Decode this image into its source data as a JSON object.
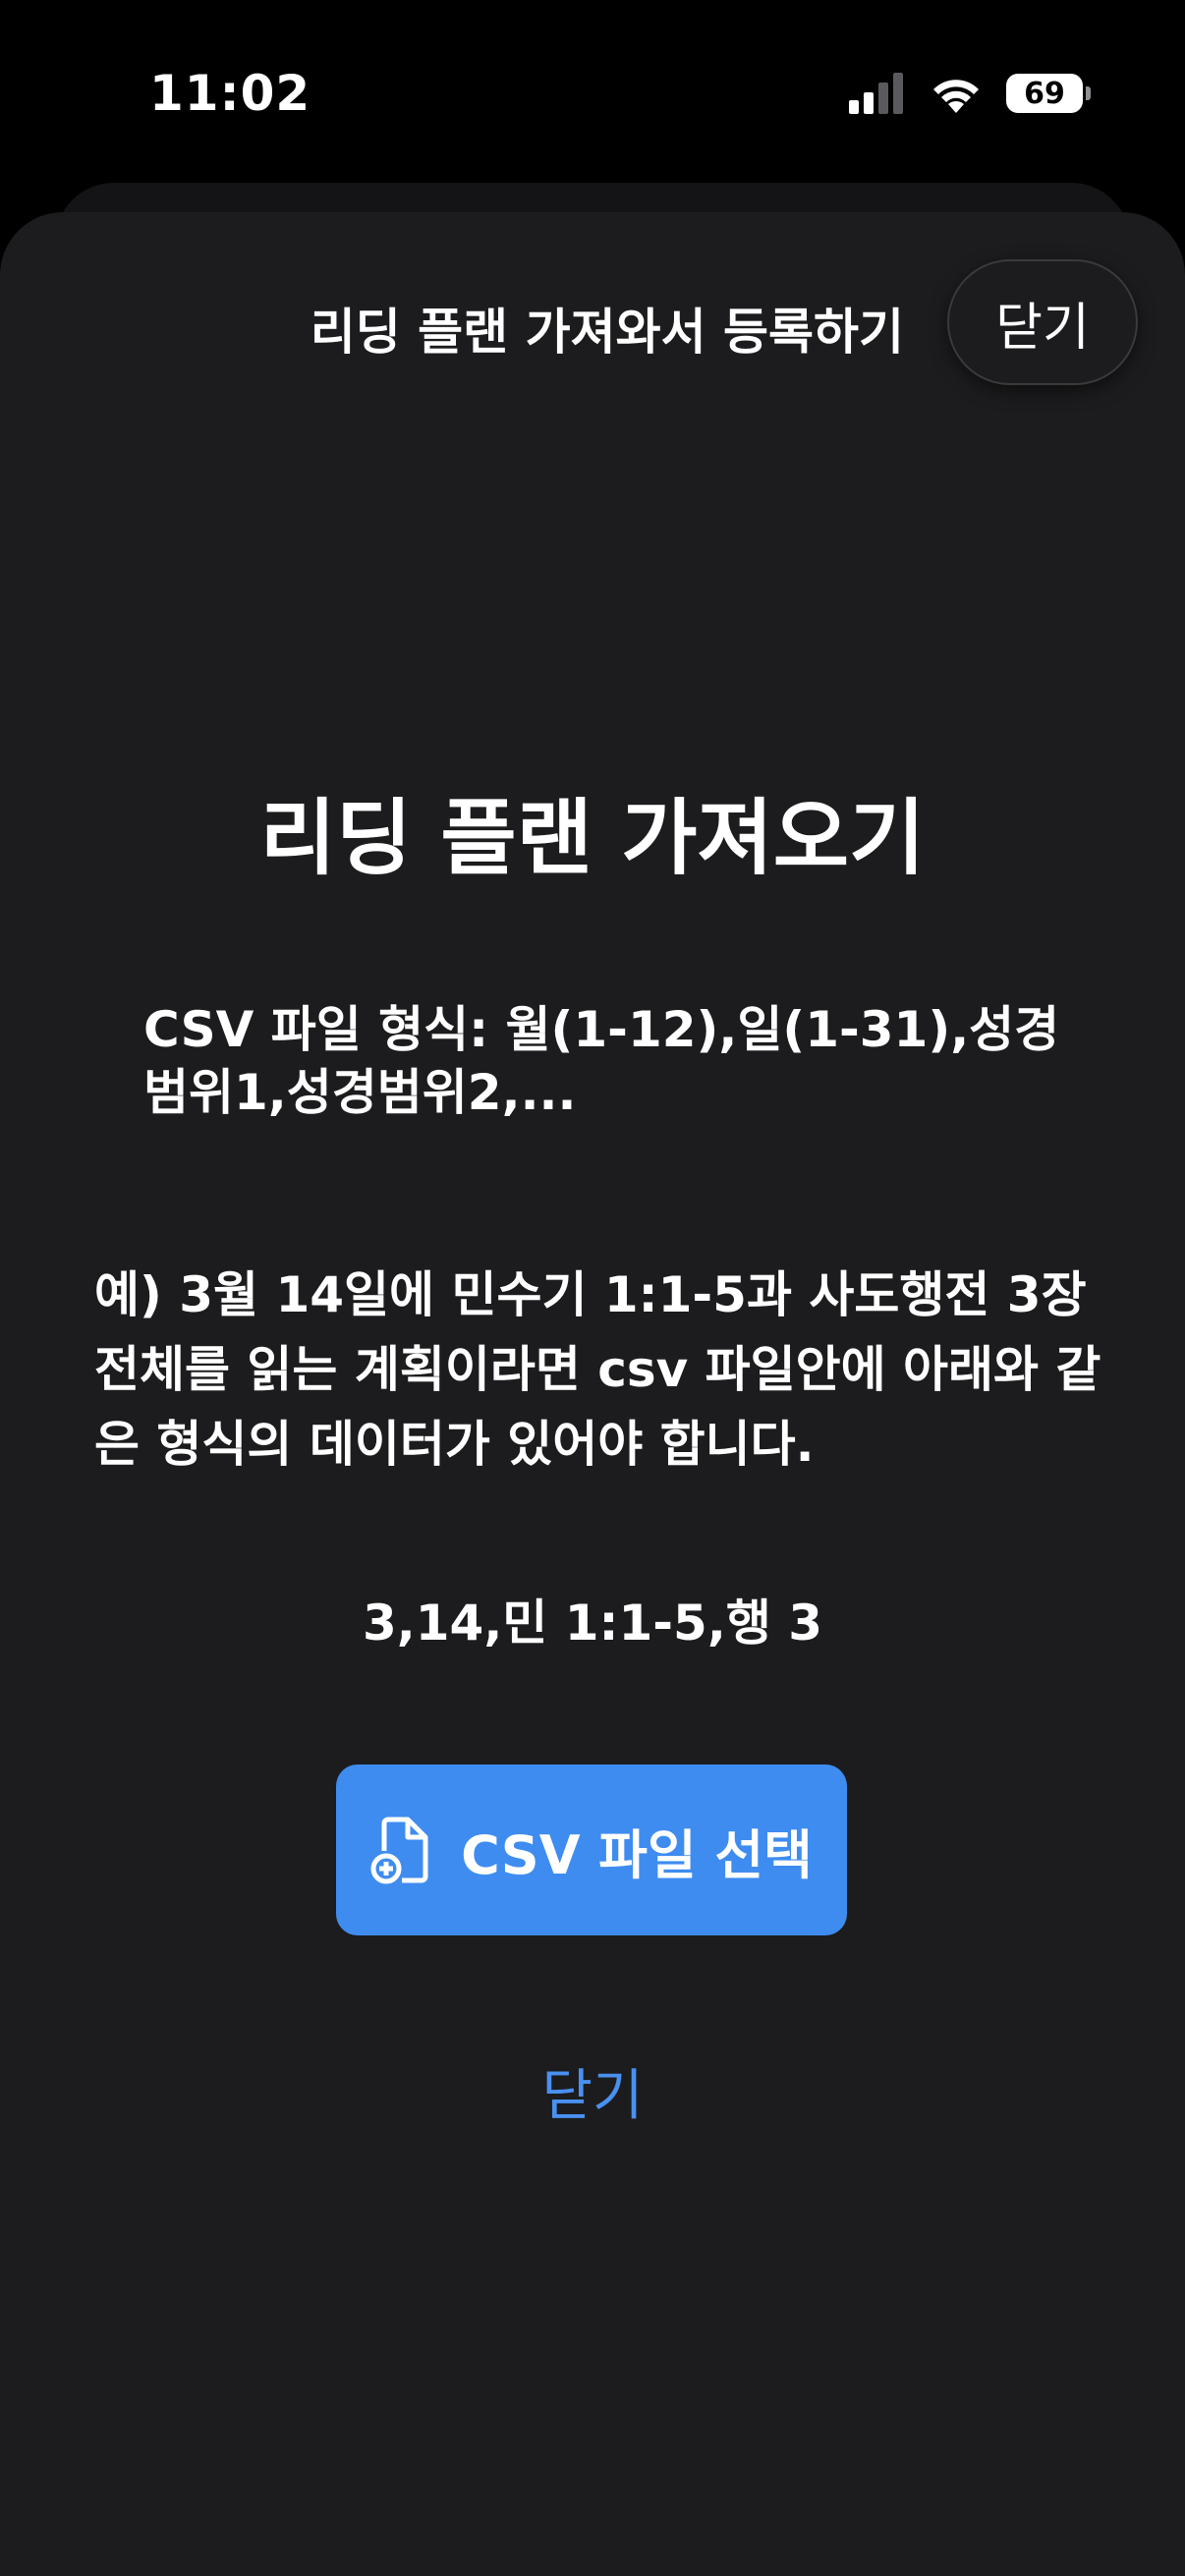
{
  "status_bar": {
    "time": "11:02",
    "battery": "69"
  },
  "sheet": {
    "title": "리딩 플랜 가져와서 등록하기",
    "close_button": "닫기"
  },
  "content": {
    "heading": "리딩 플랜 가져오기",
    "format_description": "CSV 파일 형식: 월(1-12),일(1-31),성경범위1,성경범위2,...",
    "example_description": "예) 3월 14일에 민수기 1:1-5과 사도행전 3장 전체를 읽는 계획이라면 csv 파일안에 아래와 같은 형식의 데이터가 있어야 합니다.",
    "sample_line": "3,14,민 1:1-5,행 3",
    "select_button_label": "CSV 파일 선택",
    "close_link": "닫기"
  },
  "colors": {
    "background": "#000000",
    "sheet": "#1c1c1e",
    "accent_button": "#3f8cf0",
    "link": "#4a90f0"
  },
  "icons": [
    "signal-icon",
    "wifi-icon",
    "battery-icon",
    "file-plus-icon"
  ]
}
